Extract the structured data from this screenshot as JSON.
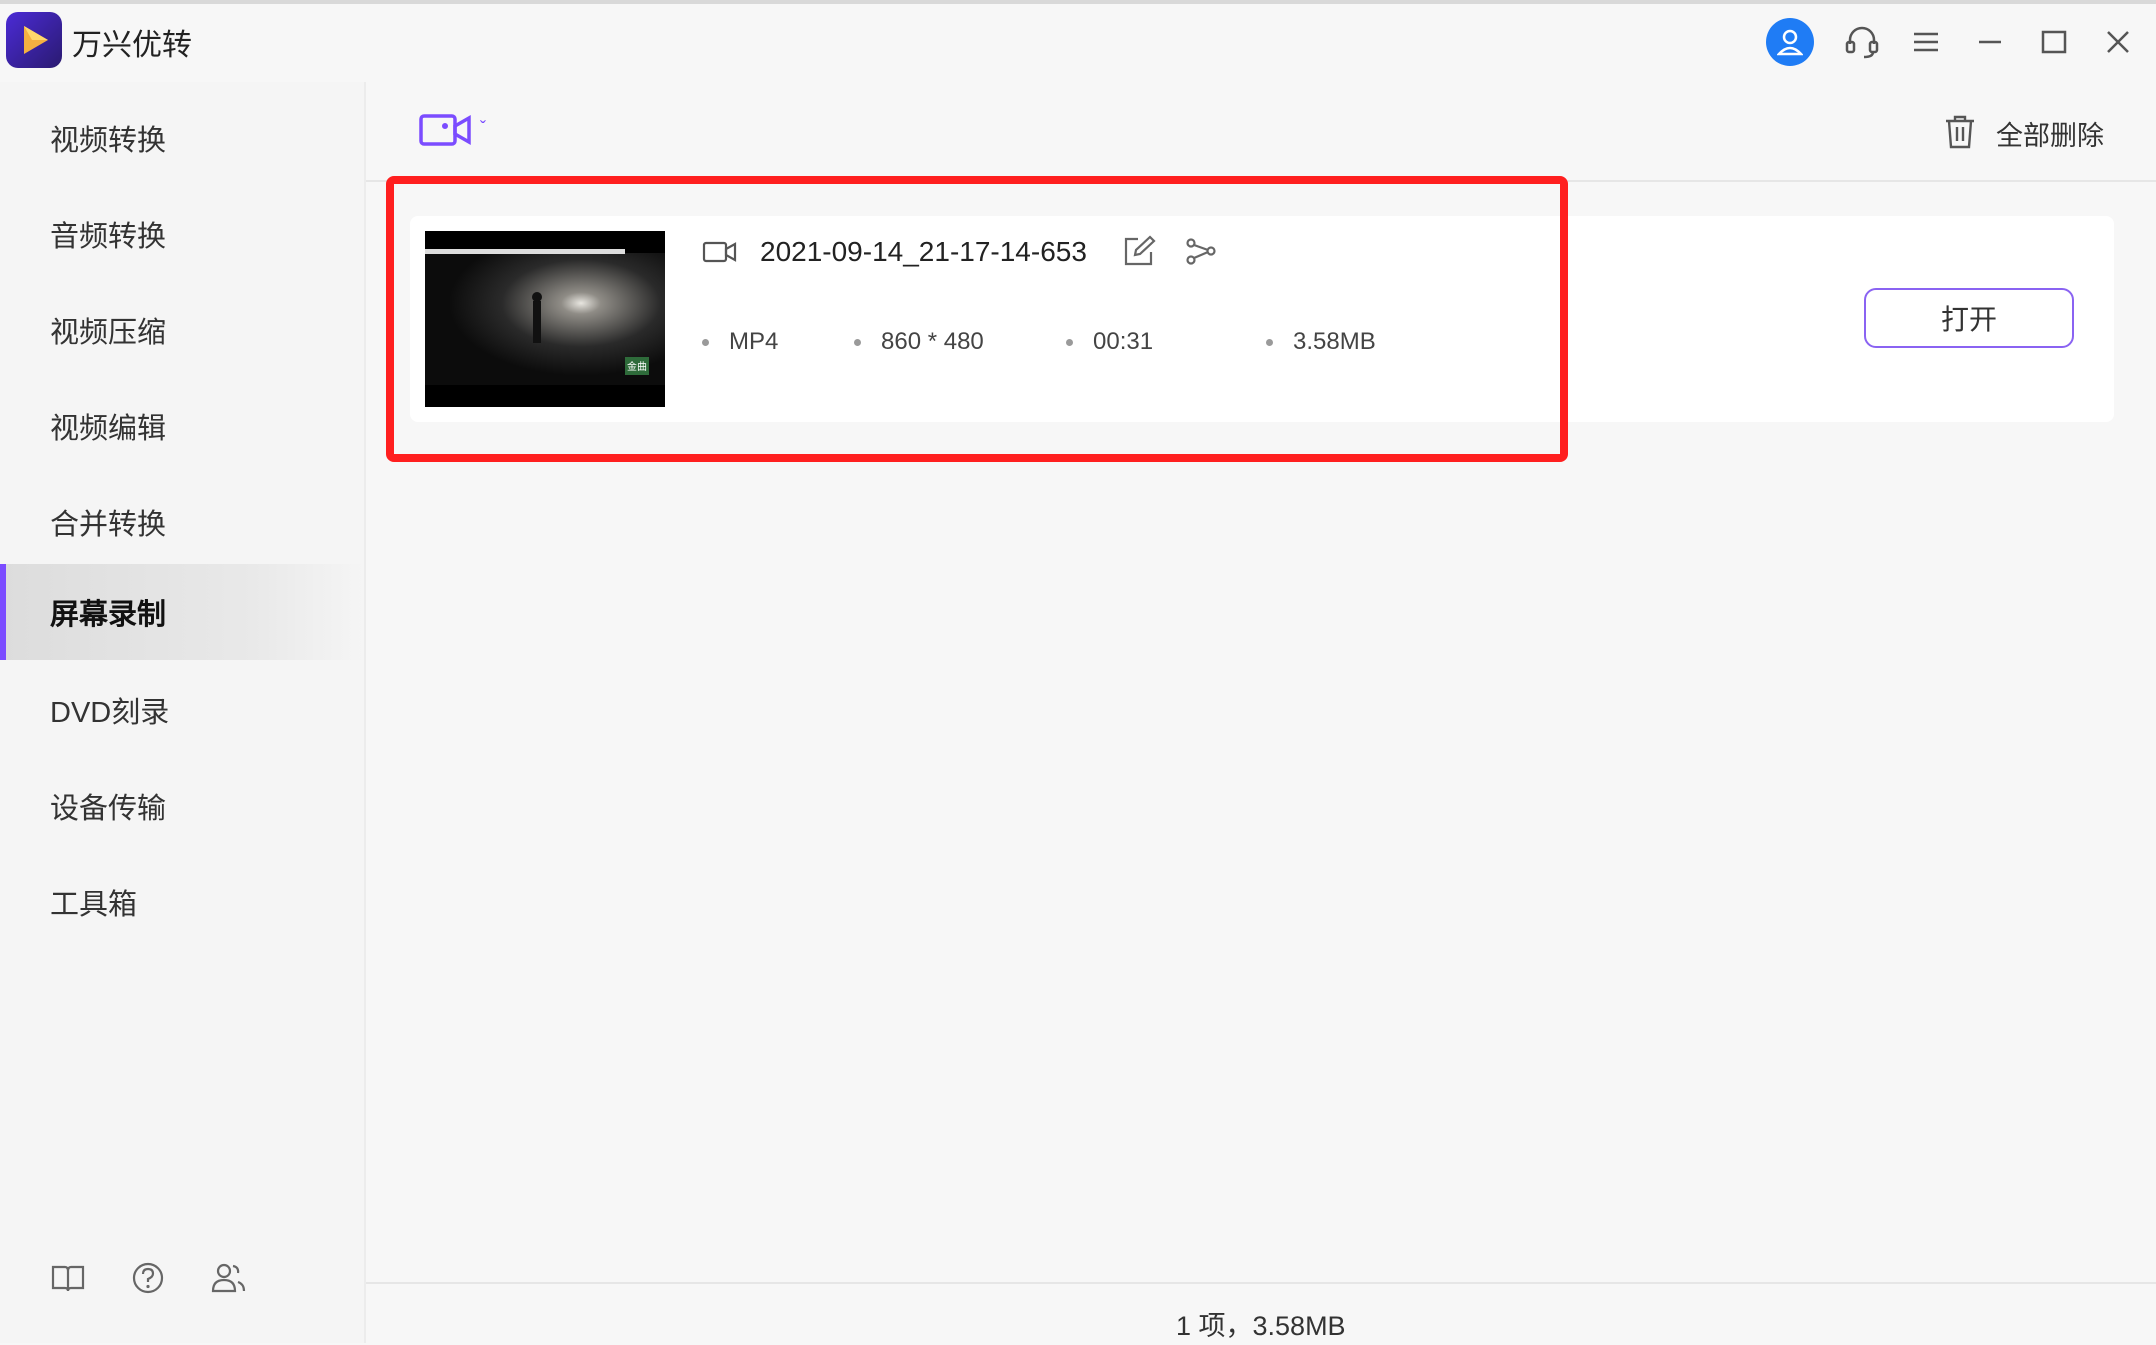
{
  "app": {
    "title": "万兴优转"
  },
  "sidebar": {
    "items": [
      {
        "label": "视频转换"
      },
      {
        "label": "音频转换"
      },
      {
        "label": "视频压缩"
      },
      {
        "label": "视频编辑"
      },
      {
        "label": "合并转换"
      },
      {
        "label": "屏幕录制",
        "active": true
      },
      {
        "label": "DVD刻录"
      },
      {
        "label": "设备传输"
      },
      {
        "label": "工具箱"
      }
    ],
    "bottom_icons": [
      "book-icon",
      "help-icon",
      "users-icon"
    ]
  },
  "toolbar": {
    "delete_all_label": "全部删除"
  },
  "file": {
    "name": "2021-09-14_21-17-14-653",
    "format": "MP4",
    "resolution": "860 * 480",
    "duration": "00:31",
    "size": "3.58MB",
    "open_label": "打开",
    "thumbnail_caption": "金曲"
  },
  "footer": {
    "summary": "1 项，3.58MB"
  },
  "colors": {
    "accent": "#7b4cff",
    "highlight": "#ff1f1f",
    "user_button": "#1f7cf5"
  }
}
